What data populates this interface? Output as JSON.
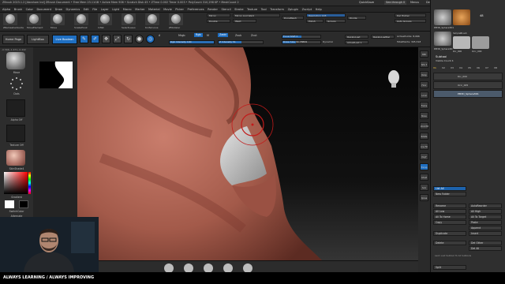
{
  "titlebar": {
    "title": "ZBrush 2023.1.2 [Abraham Ind]   ZBrush Document   • Free Mem 23.11GB • Active Mem 906 • Scratch Disk 45 • ZTime 0.002 Timer 0.003 • PolyCount 310,298 KP • MeshCount 2",
    "quicksave": "QuickSave",
    "see_through": "See-through 0",
    "menus_label": "Menus",
    "default_script": "DefaultZScript"
  },
  "menubar": {
    "items": [
      "Alpha",
      "Brush",
      "Color",
      "Document",
      "Draw",
      "Dynamics",
      "Edit",
      "File",
      "Layer",
      "Light",
      "Macro",
      "Marker",
      "Material",
      "Movie",
      "Picker",
      "Preferences",
      "Render",
      "Stencil",
      "Stroke",
      "Texture",
      "Tool",
      "Transform",
      "Zplugin",
      "Zscript",
      "Help"
    ]
  },
  "topshelf": {
    "thumbs": [
      "ZRemesherGuide",
      "MoveElement",
      "Move",
      "SnakeHook",
      "Inflat",
      "SelectLasso",
      "KnifeCurve",
      "ZModeler"
    ],
    "buttons": [
      "Mirror",
      "Mirror And Weld",
      "Double",
      "Weld",
      "DynaMesh",
      "Resolution 128",
      "Polish",
      "Groups",
      "Divide",
      "Del Higher",
      "Auto Groups"
    ]
  },
  "toolrow": {
    "home_page": "Home Page",
    "lightbox": "LightBox",
    "live_boolean": "Live Boolean",
    "edit": "Edit",
    "draw": "Draw",
    "move": "Move",
    "scale": "Scale",
    "rotate": "Rotate",
    "a_label": "A",
    "mrgb": "Mrgb",
    "rgb": "Rgb",
    "m": "M",
    "zadd": "Zadd",
    "zsub": "Zsub",
    "zcut": "Zcut",
    "rgb_intensity": "Rgb Intensity 100",
    "z_intensity": "Z Intensity 51",
    "focal_shift": "Focal Shift 0",
    "draw_size": "Draw Size 34.78834",
    "dynamic": "Dynamic",
    "replay_last": "ReplayLast",
    "replay_last_rel": "ReplayLastRel",
    "active_points": "ActivePoints: 8,066",
    "total_points": "TotalPoints: 305,518",
    "adjust_last": "AdjustLast 1",
    "rgb_intensity_level": 1.0,
    "z_intensity_level": 0.51,
    "focal_shift_level": 0.5,
    "draw_size_level": 0.35
  },
  "statusbar_left": "-0.566,-1.471,-0.442",
  "leftpanel": {
    "brush_label": "Move",
    "stroke_label": "Dots",
    "alpha_label": "Alpha Off",
    "texture_label": "Texture Off",
    "material_label": "SkinShade4",
    "gradient_label": "Gradient",
    "switch_color": "SwitchColor",
    "alternate": "Alternate"
  },
  "rightcol": {
    "buttons": [
      "BPR",
      "SPix 3",
      "Persp",
      "Floor",
      "Local",
      "Frame",
      "Move",
      "Zoom3D",
      "Rotate",
      "Line Fill",
      "PolyF",
      "Transp",
      "Ghost",
      "Solo",
      "Xpose"
    ]
  },
  "tray": {
    "thumbs": [
      "PM3D_Sphere3D1",
      "SimpleBrush",
      "PM3D_Sphere3D1",
      "Dic_000",
      "Oric_000"
    ],
    "count": "48",
    "subtool_title": "Subtool",
    "visible_count": "Visible Count 4",
    "v_labels": [
      "V1",
      "V2",
      "V3",
      "V4",
      "V5",
      "V6",
      "V7",
      "V8"
    ],
    "subtools": [
      "Dic_000",
      "Oric_005",
      "PM3D_Sphere3D1"
    ],
    "list_all": "List All",
    "new_folder": "New Folder",
    "rename": "Rename",
    "auto_reorder": "AutoReorder",
    "all_low": "All Low",
    "all_high": "All High",
    "all_to_home": "All To Home",
    "all_to_target": "All To Target",
    "copy": "Copy",
    "paste": "Paste",
    "append": "Append",
    "duplicate": "Duplicate",
    "insert": "Insert",
    "delete": "Delete",
    "del_other": "Del Other",
    "del_all": "Del All",
    "split": "Split",
    "note": "Last: Lost Subtool To All Subtools"
  },
  "banner": {
    "text": "ALWAYS LEARNING  /  ALWAYS IMPROVING"
  },
  "colors": {
    "accent": "#1f6fc2",
    "skin": "#a35a4a",
    "bg": "#2b2b2b"
  }
}
